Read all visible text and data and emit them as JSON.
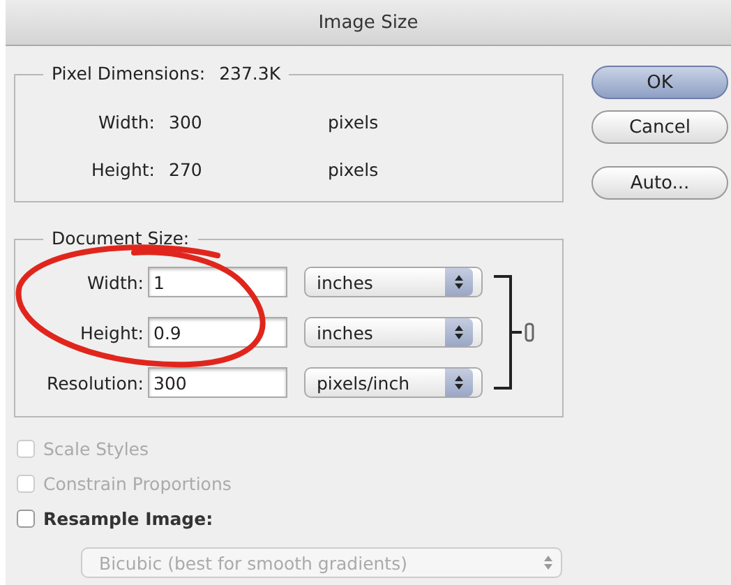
{
  "window": {
    "title": "Image Size"
  },
  "pixel_dimensions": {
    "legend": "Pixel Dimensions:",
    "size": "237.3K",
    "rows": [
      {
        "label": "Width:",
        "value": "300",
        "unit": "pixels"
      },
      {
        "label": "Height:",
        "value": "270",
        "unit": "pixels"
      }
    ]
  },
  "document_size": {
    "legend": "Document Size:",
    "rows": [
      {
        "label": "Width:",
        "value": "1",
        "unit": "inches"
      },
      {
        "label": "Height:",
        "value": "0.9",
        "unit": "inches"
      },
      {
        "label": "Resolution:",
        "value": "300",
        "unit": "pixels/inch"
      }
    ]
  },
  "options": [
    {
      "label": "Scale Styles",
      "checked": false,
      "disabled": true
    },
    {
      "label": "Constrain Proportions",
      "checked": false,
      "disabled": true
    },
    {
      "label": "Resample Image:",
      "checked": false,
      "disabled": false
    }
  ],
  "resample_method": {
    "value": "Bicubic (best for smooth gradients)",
    "disabled": true
  },
  "buttons": [
    {
      "label": "OK",
      "default": true
    },
    {
      "label": "Cancel",
      "default": false
    },
    {
      "label": "Auto...",
      "default": false
    }
  ]
}
